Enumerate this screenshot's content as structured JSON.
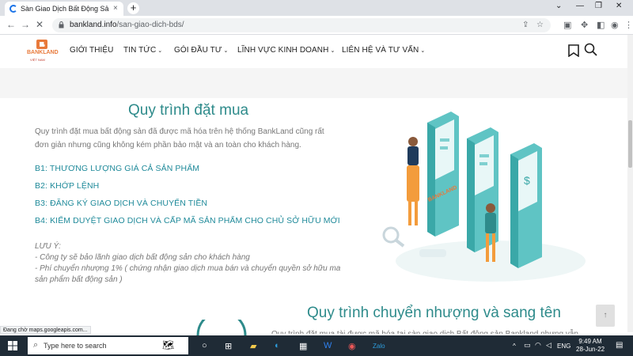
{
  "browser": {
    "tab_title": "Sàn Giao Dịch Bất Động Sản Bank",
    "tab_close": "×",
    "new_tab": "+",
    "url_host": "bankland.info",
    "url_path": "/san-giao-dich-bds/",
    "status_text": "Đang chờ maps.googleapis.com..."
  },
  "site": {
    "logo_text": "BANKLAND",
    "logo_sub": "VIỆT NAM",
    "nav": [
      {
        "label": "GIỚI THIỆU",
        "has_dropdown": false
      },
      {
        "label": "TIN TỨC",
        "has_dropdown": true
      },
      {
        "label": "GÓI ĐẦU TƯ",
        "has_dropdown": true
      },
      {
        "label": "LĨNH VỰC KINH DOANH",
        "has_dropdown": true
      },
      {
        "label": "LIÊN HỆ VÀ TƯ VẤN",
        "has_dropdown": true
      }
    ]
  },
  "section1": {
    "title": "Quy trình đặt mua",
    "intro": "Quy trình đặt mua bất động sản đã được mã hóa trên hệ thống BankLand cũng rất đơn giản nhưng cũng không kém phần bảo mật và an toàn cho khách hàng.",
    "steps": [
      "B1: THƯƠNG LƯỢNG GIÁ CẢ SẢN PHẨM",
      "B2: KHỚP LỆNH",
      "B3: ĐĂNG KÝ GIAO DỊCH VÀ CHUYỂN TIỀN",
      "B4: KIỂM DUYỆT GIAO DỊCH VÀ CẤP MÃ SẢN PHẨM CHO CHỦ SỞ HỮU MỚI"
    ],
    "note_title": "LƯU Ý:",
    "notes": [
      "- Công ty sẽ bảo lãnh giao dịch bất động sản cho khách hàng",
      "- Phí chuyển nhượng 1% ( chứng nhận giao dịch mua bán và chuyển quyền sở hữu ma sản phẩm bất động sản )"
    ],
    "kiosk_brand": "BANKLAND"
  },
  "section2": {
    "title": "Quy trình chuyển nhượng và sang tên",
    "intro_partial": "Quy trình đặt mua tài được mã hóa tại sàn giao dịch Bất động sản Bankland nhưng vẫn"
  },
  "taskbar": {
    "search_placeholder": "Type here to search",
    "lang": "ENG",
    "time": "9:49 AM",
    "date": "28-Jun-22"
  },
  "colors": {
    "teal": "#2e8b8b",
    "step_blue": "#1f8a9a",
    "brand_orange": "#e8793a"
  }
}
